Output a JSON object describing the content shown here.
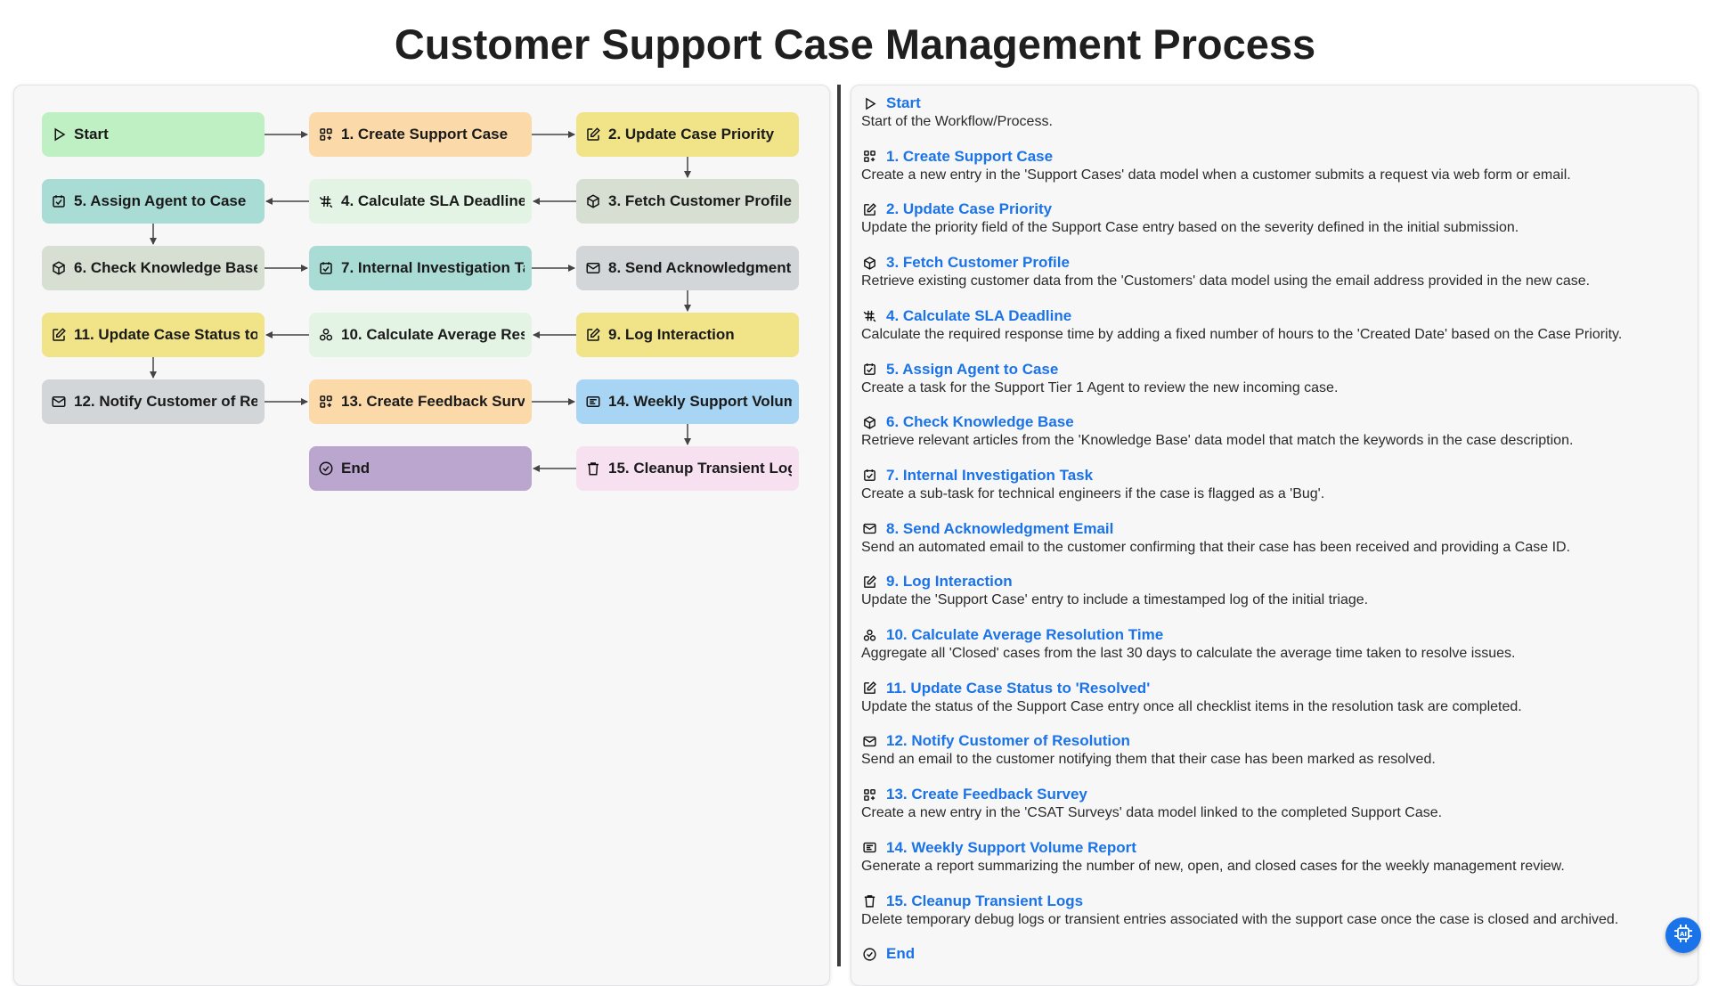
{
  "title": "Customer Support Case Management Process",
  "colors": {
    "green": "#bff0c3",
    "orange": "#fcd9a8",
    "yellow": "#f1e388",
    "sage": "#d7dfd3",
    "teal": "#a9dcd5",
    "gray": "#d2d6d8",
    "lightgreen": "#e3f4e4",
    "blue": "#a9d5f5",
    "purple": "#bba6cf",
    "pink": "#f7e1f1",
    "link": "#1a73e8"
  },
  "nodes": [
    {
      "id": "start",
      "label": "Start",
      "icon": "play-icon",
      "color": "#bff0c3"
    },
    {
      "id": "s1",
      "label": "1. Create Support Case",
      "icon": "grid-plus-icon",
      "color": "#fcd9a8"
    },
    {
      "id": "s2",
      "label": "2. Update Case Priority",
      "icon": "edit-icon",
      "color": "#f1e388"
    },
    {
      "id": "s3",
      "label": "3. Fetch Customer Profile",
      "icon": "cube-icon",
      "color": "#d7dfd3"
    },
    {
      "id": "s4",
      "label": "4. Calculate SLA Deadline",
      "icon": "hash-icon",
      "color": "#e3f4e4"
    },
    {
      "id": "s5",
      "label": "5. Assign Agent to Case",
      "icon": "checkbox-icon",
      "color": "#a9dcd5"
    },
    {
      "id": "s6",
      "label": "6. Check Knowledge Base",
      "icon": "cube-icon",
      "color": "#d7dfd3"
    },
    {
      "id": "s7",
      "label": "7. Internal Investigation Task",
      "icon": "checkbox-icon",
      "color": "#a9dcd5"
    },
    {
      "id": "s8",
      "label": "8. Send Acknowledgment Email",
      "icon": "mail-icon",
      "color": "#d2d6d8"
    },
    {
      "id": "s9",
      "label": "9. Log Interaction",
      "icon": "edit-icon",
      "color": "#f1e388"
    },
    {
      "id": "s10",
      "label": "10. Calculate Average Resolution Time",
      "icon": "aggregate-icon",
      "color": "#e3f4e4"
    },
    {
      "id": "s11",
      "label": "11. Update Case Status to 'Resolved'",
      "icon": "edit-icon",
      "color": "#f1e388"
    },
    {
      "id": "s12",
      "label": "12. Notify Customer of Resolution",
      "icon": "mail-icon",
      "color": "#d2d6d8"
    },
    {
      "id": "s13",
      "label": "13. Create Feedback Survey",
      "icon": "grid-plus-icon",
      "color": "#fcd9a8"
    },
    {
      "id": "s14",
      "label": "14. Weekly Support Volume Report",
      "icon": "report-icon",
      "color": "#a9d5f5"
    },
    {
      "id": "s15",
      "label": "15. Cleanup Transient Logs",
      "icon": "trash-icon",
      "color": "#f7e1f1"
    },
    {
      "id": "end",
      "label": "End",
      "icon": "check-circle-icon",
      "color": "#bba6cf"
    }
  ],
  "steps": [
    {
      "name": "Start",
      "icon": "play-icon",
      "desc": "Start of the Workflow/Process."
    },
    {
      "name": "1. Create Support Case",
      "icon": "grid-plus-icon",
      "desc": "Create a new entry in the 'Support Cases' data model when a customer submits a request via web form or email."
    },
    {
      "name": "2. Update Case Priority",
      "icon": "edit-icon",
      "desc": "Update the priority field of the Support Case entry based on the severity defined in the initial submission."
    },
    {
      "name": "3. Fetch Customer Profile",
      "icon": "cube-icon",
      "desc": "Retrieve existing customer data from the 'Customers' data model using the email address provided in the new case."
    },
    {
      "name": "4. Calculate SLA Deadline",
      "icon": "hash-icon",
      "desc": "Calculate the required response time by adding a fixed number of hours to the 'Created Date' based on the Case Priority."
    },
    {
      "name": "5. Assign Agent to Case",
      "icon": "checkbox-icon",
      "desc": "Create a task for the Support Tier 1 Agent to review the new incoming case."
    },
    {
      "name": "6. Check Knowledge Base",
      "icon": "cube-icon",
      "desc": "Retrieve relevant articles from the 'Knowledge Base' data model that match the keywords in the case description."
    },
    {
      "name": "7. Internal Investigation Task",
      "icon": "checkbox-icon",
      "desc": "Create a sub-task for technical engineers if the case is flagged as a 'Bug'."
    },
    {
      "name": "8. Send Acknowledgment Email",
      "icon": "mail-icon",
      "desc": "Send an automated email to the customer confirming that their case has been received and providing a Case ID."
    },
    {
      "name": "9. Log Interaction",
      "icon": "edit-icon",
      "desc": "Update the 'Support Case' entry to include a timestamped log of the initial triage."
    },
    {
      "name": "10. Calculate Average Resolution Time",
      "icon": "aggregate-icon",
      "desc": "Aggregate all 'Closed' cases from the last 30 days to calculate the average time taken to resolve issues."
    },
    {
      "name": "11. Update Case Status to 'Resolved'",
      "icon": "edit-icon",
      "desc": "Update the status of the Support Case entry once all checklist items in the resolution task are completed."
    },
    {
      "name": "12. Notify Customer of Resolution",
      "icon": "mail-icon",
      "desc": "Send an email to the customer notifying them that their case has been marked as resolved."
    },
    {
      "name": "13. Create Feedback Survey",
      "icon": "grid-plus-icon",
      "desc": "Create a new entry in the 'CSAT Surveys' data model linked to the completed Support Case."
    },
    {
      "name": "14. Weekly Support Volume Report",
      "icon": "report-icon",
      "desc": "Generate a report summarizing the number of new, open, and closed cases for the weekly management review."
    },
    {
      "name": "15. Cleanup Transient Logs",
      "icon": "trash-icon",
      "desc": "Delete temporary debug logs or transient entries associated with the support case once the case is closed and archived."
    },
    {
      "name": "End",
      "icon": "check-circle-icon",
      "desc": ""
    }
  ],
  "fab_icon": "ai-chip-icon"
}
